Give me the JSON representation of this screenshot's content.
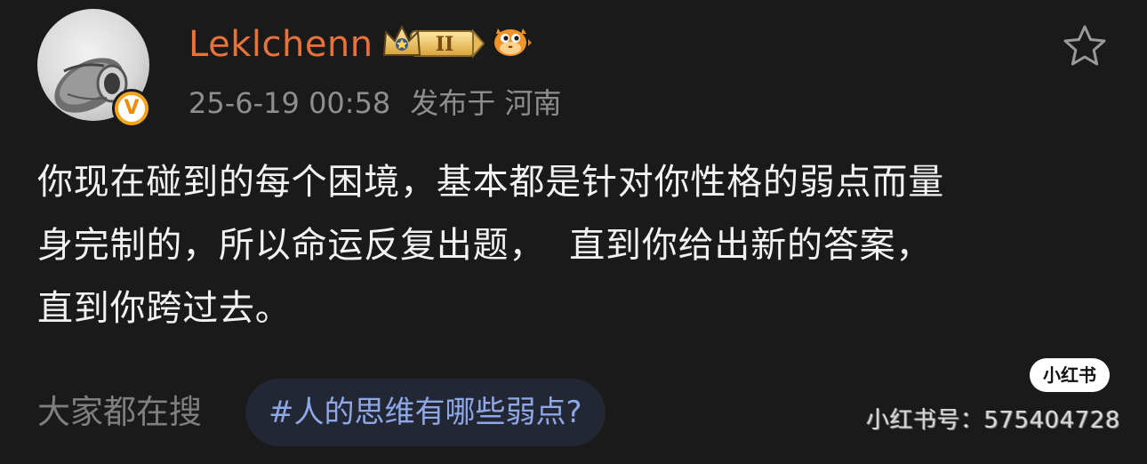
{
  "post": {
    "username": "Leklchenn",
    "level_badge": "II",
    "timestamp": "25-6-19 00:58",
    "location": "发布于 河南",
    "body_lines": [
      "你现在碰到的每个困境，基本都是针对你性格的弱点而量",
      "身完制的，所以命运反复出题，  直到你给出新的答案，",
      "直到你跨过去。"
    ]
  },
  "footer": {
    "search_label": "大家都在搜",
    "topic": "#人的思维有哪些弱点?"
  },
  "watermark": {
    "logo_text": "小红书",
    "id_text": "小红书号：575404728"
  },
  "icons": {
    "avatar": "avatar-image",
    "verified": "verified-v-badge",
    "crown": "crown-level-badge",
    "fish": "pufferfish-badge",
    "star": "star-outline-icon"
  },
  "colors": {
    "background": "#1a1a1a",
    "username": "#e8733a",
    "meta": "#8e8e8e",
    "body": "#f2f2f2",
    "topic_text": "#8ea7e6",
    "topic_bg": "#232733",
    "verified": "#f4a31c"
  }
}
